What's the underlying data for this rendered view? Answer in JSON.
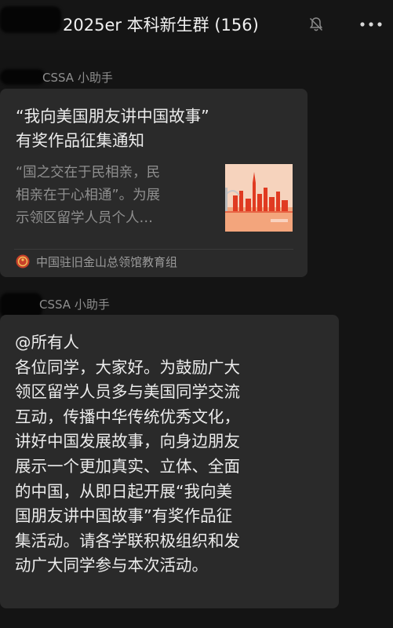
{
  "header": {
    "title": "2025er 本科新生群 (156)",
    "mute_icon": "bell-muted-icon",
    "more_icon": "ellipsis-icon"
  },
  "messages": [
    {
      "sender": "CSSA 小助手",
      "card": {
        "title": "“我向美国朋友讲中国故事”有奖作品征集通知",
        "title_lines": [
          "“我向美国朋友讲中国故事”",
          "有奖作品征集通知"
        ],
        "description_lines": [
          "“国之交在于民相亲，民",
          "相亲在于心相通”。为展",
          "示领区留学人员个人…"
        ],
        "source": "中国驻旧金山总领馆教育组",
        "colors": {
          "thumb_bg": "#f6c7a9",
          "thumb_accent": "#e03a21"
        }
      }
    },
    {
      "sender": "CSSA 小助手",
      "text_lines": [
        "@所有人",
        "各位同学，大家好。为鼓励广大",
        "领区留学人员多与美国同学交流",
        "互动，传播中华传统优秀文化，",
        "讲好中国发展故事，向身边朋友",
        "展示一个更加真实、立体、全面",
        "的中国，从即日起开展“我向美",
        "国朋友讲中国故事”有奖作品征",
        "集活动。请各学联积极组织和发",
        "动广大同学参与本次活动。"
      ]
    }
  ],
  "colors": {
    "background": "#141414",
    "bubble": "#2a2a2a",
    "text": "#ececec",
    "muted_text": "#8f8f8f"
  }
}
